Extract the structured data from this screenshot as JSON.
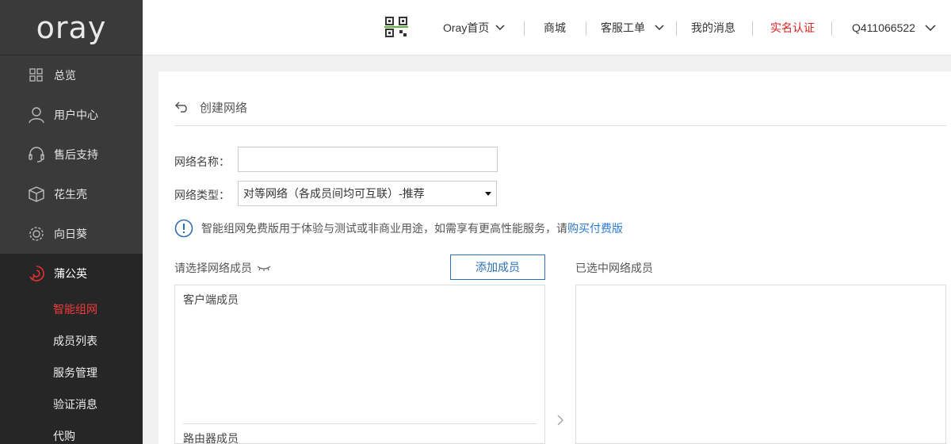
{
  "sidebar": {
    "logo_text": "oray",
    "items": [
      {
        "label": "总览",
        "icon": "grid-icon"
      },
      {
        "label": "用户中心",
        "icon": "user-icon"
      },
      {
        "label": "售后支持",
        "icon": "headset-icon"
      },
      {
        "label": "花生壳",
        "icon": "cube-icon"
      },
      {
        "label": "向日葵",
        "icon": "sunflower-icon"
      },
      {
        "label": "蒲公英",
        "icon": "dandelion-icon"
      }
    ],
    "sub_items": [
      {
        "label": "智能组网",
        "active": true
      },
      {
        "label": "成员列表"
      },
      {
        "label": "服务管理"
      },
      {
        "label": "验证消息"
      },
      {
        "label": "代购"
      }
    ]
  },
  "header": {
    "home_label": "Oray首页",
    "shop_label": "商城",
    "ticket_label": "客服工单",
    "messages_label": "我的消息",
    "verify_label": "实名认证",
    "account_label": "Q411066522",
    "verify_color": "#e02020"
  },
  "main": {
    "title": "创建网络",
    "name_label": "网络名称：",
    "name_value": "",
    "type_label": "网络类型：",
    "type_value": "对等网络（各成员间均可互联）-推荐",
    "notice_text": "智能组网免费版用于体验与测试或非商业用途，如需享有更高性能服务，请",
    "notice_link": "购买付费版",
    "select_members_label": "请选择网络成员",
    "add_member_button": "添加成员",
    "selected_members_label": "已选中网络成员",
    "group_client": "客户端成员",
    "group_router": "路由器成员"
  }
}
